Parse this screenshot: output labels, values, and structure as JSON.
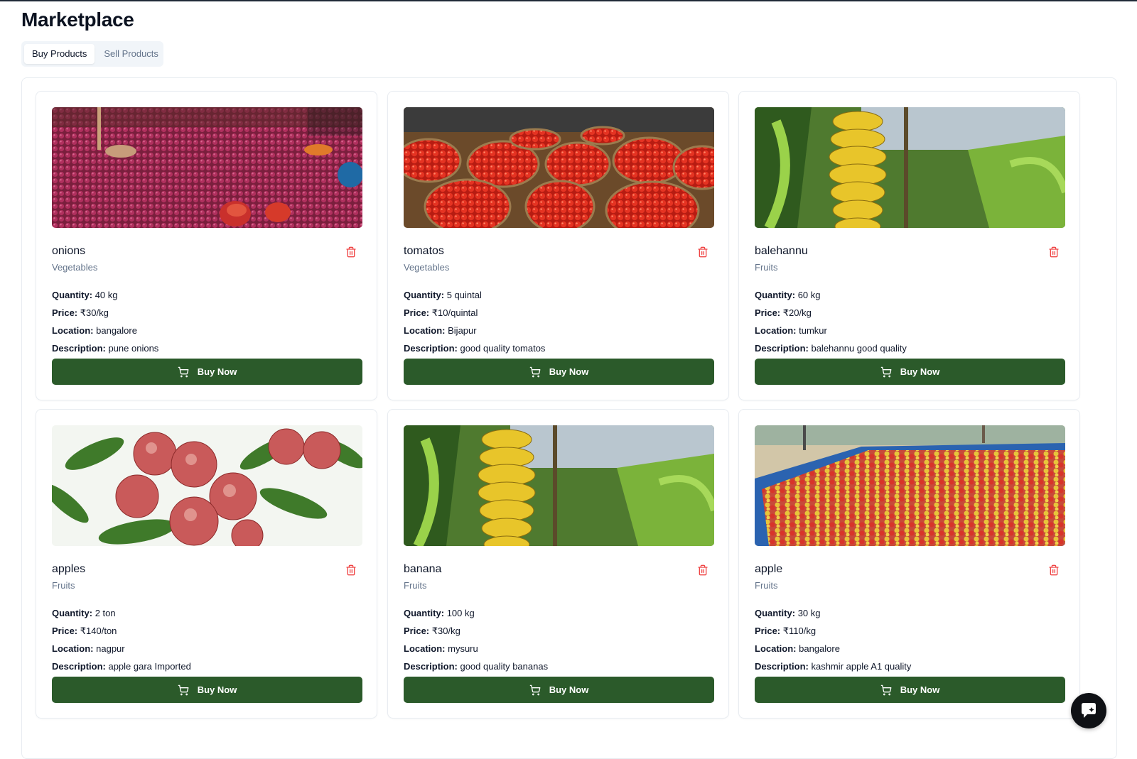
{
  "page": {
    "title": "Marketplace"
  },
  "tabs": [
    {
      "label": "Buy Products",
      "active": true
    },
    {
      "label": "Sell Products",
      "active": false
    }
  ],
  "field_labels": {
    "quantity": "Quantity:",
    "price": "Price:",
    "location": "Location:",
    "description": "Description:"
  },
  "buy_label": "Buy Now",
  "products": [
    {
      "name": "onions",
      "category": "Vegetables",
      "quantity": "40 kg",
      "price": "₹30/kg",
      "location": "bangalore",
      "description": "pune onions",
      "image": "onions-market-photo"
    },
    {
      "name": "tomatos",
      "category": "Vegetables",
      "quantity": "5 quintal",
      "price": "₹10/quintal",
      "location": "Bijapur",
      "description": "good quality tomatos",
      "image": "tomato-baskets-photo"
    },
    {
      "name": "balehannu",
      "category": "Fruits",
      "quantity": "60 kg",
      "price": "₹20/kg",
      "location": "tumkur",
      "description": "balehannu good quality",
      "image": "banana-plant-photo"
    },
    {
      "name": "apples",
      "category": "Fruits",
      "quantity": "2 ton",
      "price": "₹140/ton",
      "location": "nagpur",
      "description": "apple gara Imported",
      "image": "apple-tree-photo"
    },
    {
      "name": "banana",
      "category": "Fruits",
      "quantity": "100 kg",
      "price": "₹30/kg",
      "location": "mysuru",
      "description": "good quality bananas",
      "image": "banana-plant-photo"
    },
    {
      "name": "apple",
      "category": "Fruits",
      "quantity": "30 kg",
      "price": "₹110/kg",
      "location": "bangalore",
      "description": "kashmir apple A1 quality",
      "image": "apples-heap-photo"
    }
  ],
  "colors": {
    "accent": "#2b5a2a",
    "delete": "#ef4444",
    "muted": "#64748b"
  },
  "icons": {
    "delete": "trash-icon",
    "buy": "cart-icon",
    "chat": "chat-icon"
  }
}
